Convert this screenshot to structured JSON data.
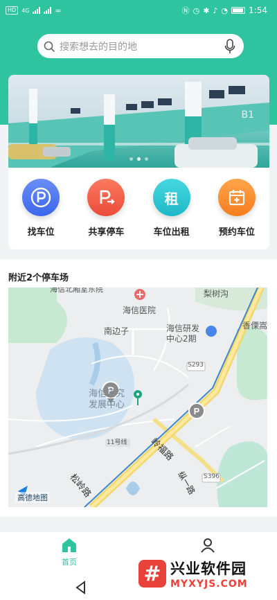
{
  "status_bar": {
    "time": "1:54",
    "sim_badge": "HD",
    "network": "4G"
  },
  "search": {
    "placeholder": "搜索想去的目的地"
  },
  "banner": {
    "slides": 3,
    "active_slide": 2,
    "sign": "B1"
  },
  "quick_entries": [
    {
      "label": "找车位",
      "icon": "parking-icon",
      "glyph": "P",
      "color": "#3c66ec"
    },
    {
      "label": "共享停车",
      "icon": "share-parking-icon",
      "glyph": "P",
      "color": "#ec4b3a"
    },
    {
      "label": "车位出租",
      "icon": "rent-icon",
      "glyph": "租",
      "color": "#1fb8c8"
    },
    {
      "label": "预约车位",
      "icon": "calendar-icon",
      "glyph": "+",
      "color": "#f57d1e"
    }
  ],
  "nearby": {
    "title": "附近2个停车场",
    "map_labels": {
      "top_cut": "海信北厢室东院",
      "hospital": "海信医院",
      "lishugou": "梨树沟",
      "nanbianzi": "南边子",
      "research_center": "海信研发\n中心2期",
      "xiangli": "香傈嵩",
      "s293": "S293",
      "dev_center": "海信研究\n发展中心",
      "line11": "11号线",
      "lingfu_road": "岭福路",
      "s396": "S396",
      "songling_road": "松岭路",
      "zongyi_road": "纵一路",
      "map_brand": "高德地图"
    }
  },
  "tabbar": {
    "items": [
      {
        "label": "首页",
        "icon": "home-icon",
        "active": true
      },
      {
        "label": "",
        "icon": "profile-icon",
        "active": false
      }
    ]
  },
  "watermark": {
    "title": "兴业软件园",
    "url": "MYXYJS.COM"
  },
  "colors": {
    "primary": "#2ec4a0"
  }
}
